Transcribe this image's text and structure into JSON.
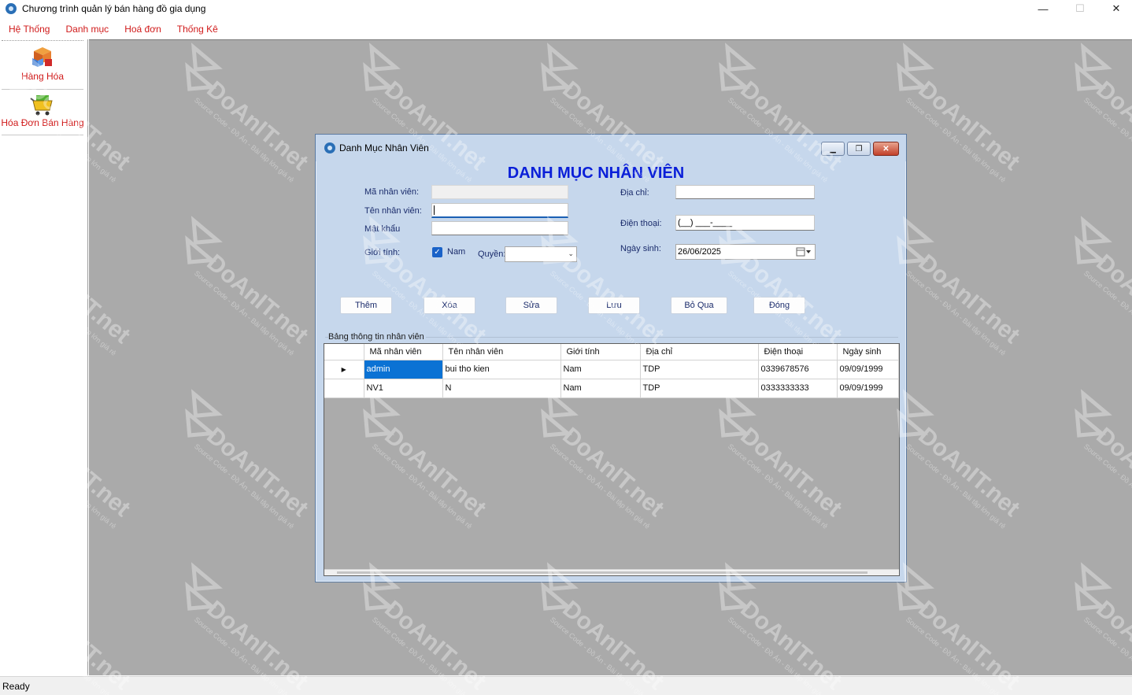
{
  "app": {
    "title": "Chương trình quản lý bán hàng đồ gia dụng",
    "window_controls": {
      "minimize": "—",
      "maximize": "☐",
      "close": "✕"
    }
  },
  "menu": {
    "items": [
      {
        "label": "Hệ Thống"
      },
      {
        "label": "Danh mục"
      },
      {
        "label": "Hoá đơn"
      },
      {
        "label": "Thống Kê"
      }
    ]
  },
  "sidebar": {
    "tools": [
      {
        "label": "Hàng Hóa",
        "icon": "boxes-icon"
      },
      {
        "label": "Hóa Đơn Bán Hàng",
        "icon": "shopping-cart-icon"
      }
    ]
  },
  "child_window": {
    "title": "Danh Mục Nhân Viên",
    "controls": {
      "minimize": "▁",
      "restore": "❐",
      "close": "✕"
    },
    "heading": "DANH MỤC NHÂN VIÊN",
    "form": {
      "ma_nv_label": "Mã nhân viên:",
      "ma_nv_value": "",
      "ten_nv_label": "Tên nhân viên:",
      "ten_nv_value": "",
      "mat_khau_label": "Mật khẩu",
      "mat_khau_value": "",
      "gioi_tinh_label": "Giới tính:",
      "gioi_tinh_checkbox_label": "Nam",
      "gioi_tinh_checked": true,
      "quyen_label": "Quyền:",
      "quyen_value": "",
      "dia_chi_label": "Địa chỉ:",
      "dia_chi_value": "",
      "dien_thoai_label": "Điện thoại:",
      "dien_thoai_mask": "(__) ___-____",
      "ngay_sinh_label": "Ngày sinh:",
      "ngay_sinh_value": "26/06/2025"
    },
    "buttons": {
      "them": "Thêm",
      "xoa": "Xóa",
      "sua": "Sửa",
      "luu": "Lưu",
      "bo_qua": "Bỏ Qua",
      "dong": "Đóng"
    },
    "grid": {
      "group_label": "Bảng thông tin nhân viên",
      "columns": [
        "Mã nhân viên",
        "Tên nhân viên",
        "Giới tính",
        "Địa chỉ",
        "Điện thoại",
        "Ngày sinh"
      ],
      "rows": [
        [
          "admin",
          "bui tho kien",
          "Nam",
          "TDP",
          "0339678576",
          "09/09/1999"
        ],
        [
          "NV1",
          "N",
          "Nam",
          "TDP",
          "0333333333",
          "09/09/1999"
        ]
      ],
      "current_row_marker": "▶"
    }
  },
  "status": {
    "text": "Ready"
  },
  "watermark": {
    "text": "DoAnIT.net",
    "subtext": "Source Code - Đồ Án - Bài tập lớn giá rẻ"
  },
  "colors": {
    "menu_text": "#d01a1a",
    "heading": "#0a1fd8",
    "mdi_bg": "#aaaaaa",
    "child_bg": "#c6d7ec",
    "selection": "#0b72d4"
  }
}
